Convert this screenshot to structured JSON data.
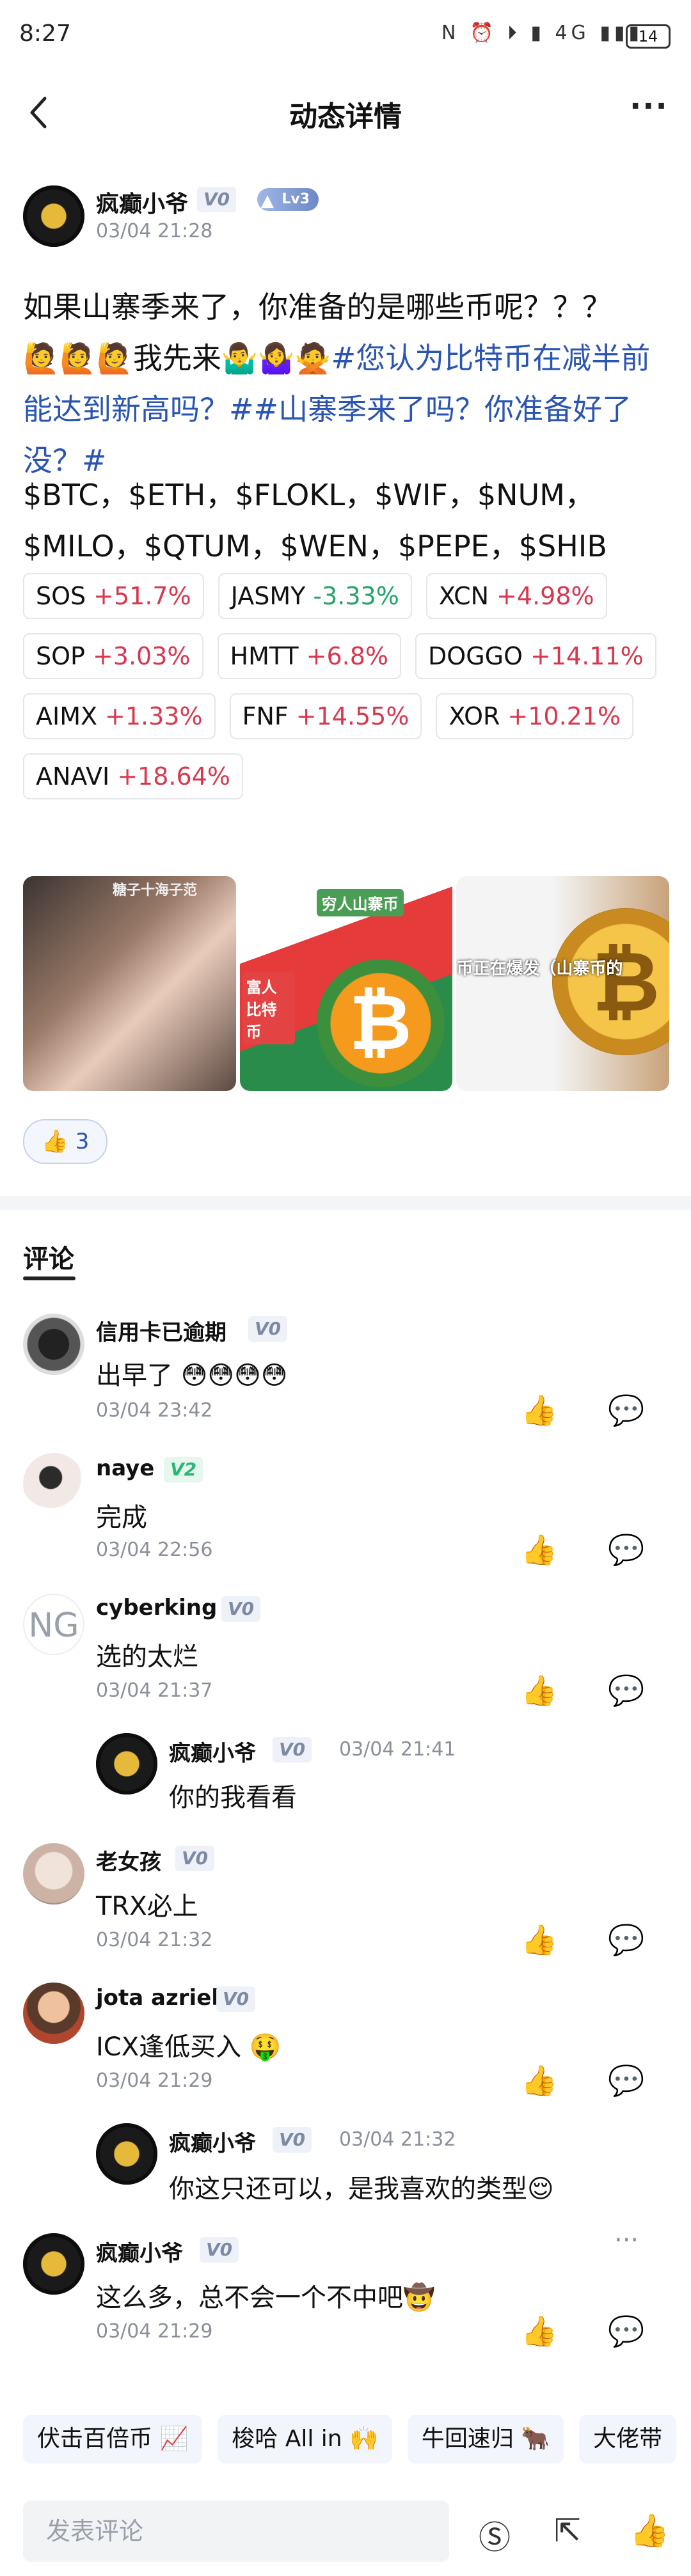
{
  "status_bar": {
    "time": "8:27",
    "icons": "N ⏰ ⏵ ▮ 4G ▮▮▮",
    "battery": "14"
  },
  "nav": {
    "title": "动态详情",
    "back_icon": "chevron-left-icon",
    "more_icon": "more-icon",
    "more_label": "···"
  },
  "post": {
    "author": "疯癫小爷",
    "verified": "V0",
    "level": "Lv3",
    "time": "03/04 21:28",
    "text_line1": "如果山寨季来了，你准备的是哪些币呢？？？",
    "text_emojis": "🙋🙋🙋我先来🤷‍♂️🤷‍♀️🙅",
    "text_link1": "#您认为比特币在减半前能达到新高吗？#",
    "text_link2": "#山寨季来了吗？你准备好了没？#",
    "tickers_line1": "$BTC，$ETH，$FLOKL，$WIF，$NUM，",
    "tickers_line2": "$MILO，$QTUM，$WEN，$PEPE，$SHIB",
    "chips": [
      {
        "symbol": "SOS",
        "change": "+51.7%",
        "dir": "up"
      },
      {
        "symbol": "JASMY",
        "change": "-3.33%",
        "dir": "down"
      },
      {
        "symbol": "XCN",
        "change": "+4.98%",
        "dir": "up"
      },
      {
        "symbol": "SOP",
        "change": "+3.03%",
        "dir": "up"
      },
      {
        "symbol": "HMTT",
        "change": "+6.8%",
        "dir": "up"
      },
      {
        "symbol": "DOGGO",
        "change": "+14.11%",
        "dir": "up"
      },
      {
        "symbol": "AIMX",
        "change": "+1.33%",
        "dir": "up"
      },
      {
        "symbol": "FNF",
        "change": "+14.55%",
        "dir": "up"
      },
      {
        "symbol": "XOR",
        "change": "+10.21%",
        "dir": "up"
      },
      {
        "symbol": "ANAVI",
        "change": "+18.64%",
        "dir": "up"
      }
    ],
    "images": [
      {
        "caption": "糖子十海子范"
      },
      {
        "caption_top": "穷人山寨币",
        "caption_left": "富人比特币",
        "coin": "₿"
      },
      {
        "caption": "币正在爆发（山寨币的",
        "coin": "₿"
      }
    ],
    "likes": {
      "icon": "👍",
      "count": "3"
    }
  },
  "comments_title": "评论",
  "comments": [
    {
      "name": "信用卡已逾期",
      "badge": "V0",
      "text": "出早了 😳😳😳😳",
      "time": "03/04 23:42"
    },
    {
      "name": "naye",
      "badge": "V2",
      "text": "完成",
      "time": "03/04 22:56"
    },
    {
      "name": "cyberking",
      "badge": "V0",
      "text": "选的太烂",
      "time": "03/04 21:37",
      "avatar_text": "NG"
    },
    {
      "name": "疯癫小爷",
      "badge": "V0",
      "text": "你的我看看",
      "time": "03/04 21:41"
    },
    {
      "name": "老女孩",
      "badge": "V0",
      "text": "TRX必上",
      "time": "03/04 21:32"
    },
    {
      "name": "jota azriel",
      "badge": "V0",
      "text": "ICX逢低买入 🤑",
      "time": "03/04 21:29"
    },
    {
      "name": "疯癫小爷",
      "badge": "V0",
      "text": "你这只还可以，是我喜欢的类型😌",
      "time": "03/04 21:32"
    },
    {
      "name": "疯癫小爷",
      "badge": "V0",
      "text": "这么多，总不会一个不中吧🤠",
      "time": "03/04 21:29"
    }
  ],
  "comment_more": "···",
  "action_icons": {
    "like": "👍",
    "reply": "💬"
  },
  "tags": [
    "伏击百倍币 📈",
    "梭哈 All in 🙌",
    "牛回速归 🐂",
    "大佬带"
  ],
  "bottom_bar": {
    "input_placeholder": "发表评论",
    "coin_icon": "Ⓢ",
    "share_icon": "⇱",
    "like_icon": "👍"
  }
}
